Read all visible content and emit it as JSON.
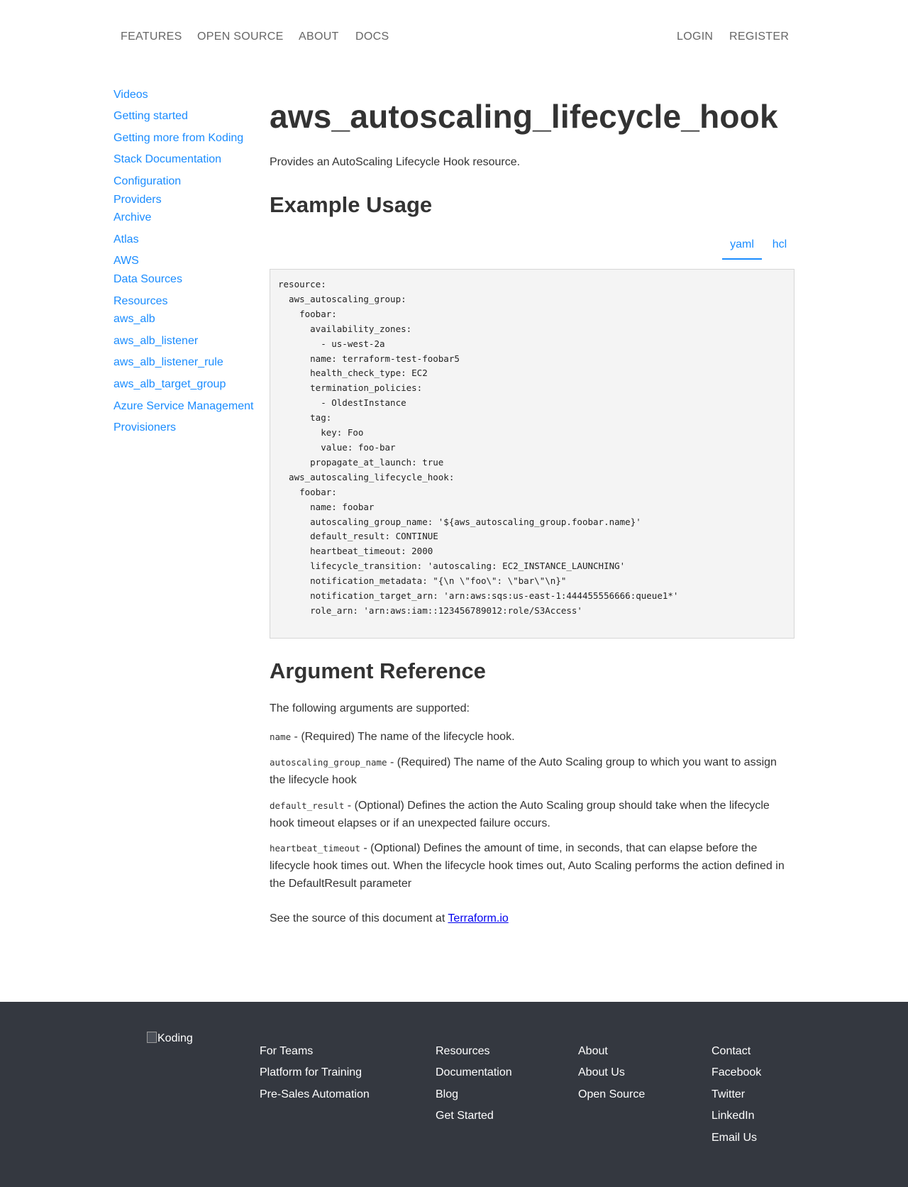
{
  "nav": {
    "left": [
      "FEATURES",
      "OPEN SOURCE",
      "ABOUT",
      "DOCS"
    ],
    "right": [
      "LOGIN",
      "REGISTER"
    ]
  },
  "sidebar": {
    "items": [
      "Videos",
      "Getting started",
      "Getting more from Koding",
      "Stack Documentation",
      "Configuration",
      "Providers",
      "Archive",
      "Atlas",
      "AWS",
      "Data Sources",
      "Resources",
      "aws_alb",
      "aws_alb_listener",
      "aws_alb_listener_rule",
      "aws_alb_target_group",
      "Azure Service Management",
      "Provisioners"
    ]
  },
  "main": {
    "title": "aws_autoscaling_lifecycle_hook",
    "lead": "Provides an AutoScaling Lifecycle Hook resource.",
    "example_heading": "Example Usage",
    "tabs": [
      "yaml",
      "hcl"
    ],
    "active_tab": "yaml",
    "code": "resource:\n  aws_autoscaling_group:\n    foobar:\n      availability_zones:\n        - us-west-2a\n      name: terraform-test-foobar5\n      health_check_type: EC2\n      termination_policies:\n        - OldestInstance\n      tag:\n        key: Foo\n        value: foo-bar\n      propagate_at_launch: true\n  aws_autoscaling_lifecycle_hook:\n    foobar:\n      name: foobar\n      autoscaling_group_name: '${aws_autoscaling_group.foobar.name}'\n      default_result: CONTINUE\n      heartbeat_timeout: 2000\n      lifecycle_transition: 'autoscaling: EC2_INSTANCE_LAUNCHING'\n      notification_metadata: \"{\\n \\\"foo\\\": \\\"bar\\\"\\n}\"\n      notification_target_arn: 'arn:aws:sqs:us-east-1:444455556666:queue1*'\n      role_arn: 'arn:aws:iam::123456789012:role/S3Access'",
    "args_heading": "Argument Reference",
    "args_intro": "The following arguments are supported:",
    "args": [
      {
        "name": "name",
        "desc": " - (Required) The name of the lifecycle hook."
      },
      {
        "name": "autoscaling_group_name",
        "desc": " - (Required) The name of the Auto Scaling group to which you want to assign the lifecycle hook"
      },
      {
        "name": "default_result",
        "desc": " - (Optional) Defines the action the Auto Scaling group should take when the lifecycle hook timeout elapses or if an unexpected failure occurs."
      },
      {
        "name": "heartbeat_timeout",
        "desc": " - (Optional) Defines the amount of time, in seconds, that can elapse before the lifecycle hook times out. When the lifecycle hook times out, Auto Scaling performs the action defined in the DefaultResult parameter"
      }
    ],
    "source_text": "See the source of this document at ",
    "source_link": "Terraform.io"
  },
  "footer": {
    "logo_alt": "Koding",
    "col1": [
      "For Teams",
      "Platform for Training",
      "Pre-Sales Automation"
    ],
    "col2": [
      "Resources",
      "Documentation",
      "Blog",
      "Get Started"
    ],
    "col3": [
      "About",
      "About Us",
      "Open Source"
    ],
    "col4": [
      "Contact",
      "Facebook",
      "Twitter",
      "LinkedIn",
      "Email Us"
    ]
  },
  "colors": {
    "link": "#1a8cff",
    "text": "#333333",
    "nav": "#666666",
    "footer_bg": "#343840",
    "code_bg": "#f4f4f4"
  }
}
